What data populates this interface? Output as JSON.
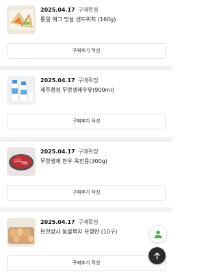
{
  "orders": [
    {
      "date": "2025.04.17",
      "status": "구매확정",
      "product_name": "통밀 에그 맛살 샌드위치 (160g)",
      "image_icon": "sandwich-image",
      "review_button_label": "구매후기 작성"
    },
    {
      "date": "2025.04.17",
      "status": "구매확정",
      "product_name": "제주청정 무항생제우유(900ml)",
      "image_icon": "milk-bottle-image",
      "review_button_label": "구매후기 작성"
    },
    {
      "date": "2025.04.17",
      "status": "구매확정",
      "product_name": "무항생제 한우 육전용(300g)",
      "image_icon": "raw-beef-image",
      "review_button_label": "구매후기 작성"
    },
    {
      "date": "2025.04.17",
      "status": "구매확정",
      "product_name": "완전방사 동물복지 유정란 (10구)",
      "image_icon": "eggs-image",
      "review_button_label": "구매후기 작성"
    }
  ],
  "floating_buttons": {
    "profile_icon": "person-icon",
    "scroll_top_icon": "arrow-up-icon",
    "profile_color": "#4caf50",
    "scroll_top_bg": "#2b2b2b"
  }
}
